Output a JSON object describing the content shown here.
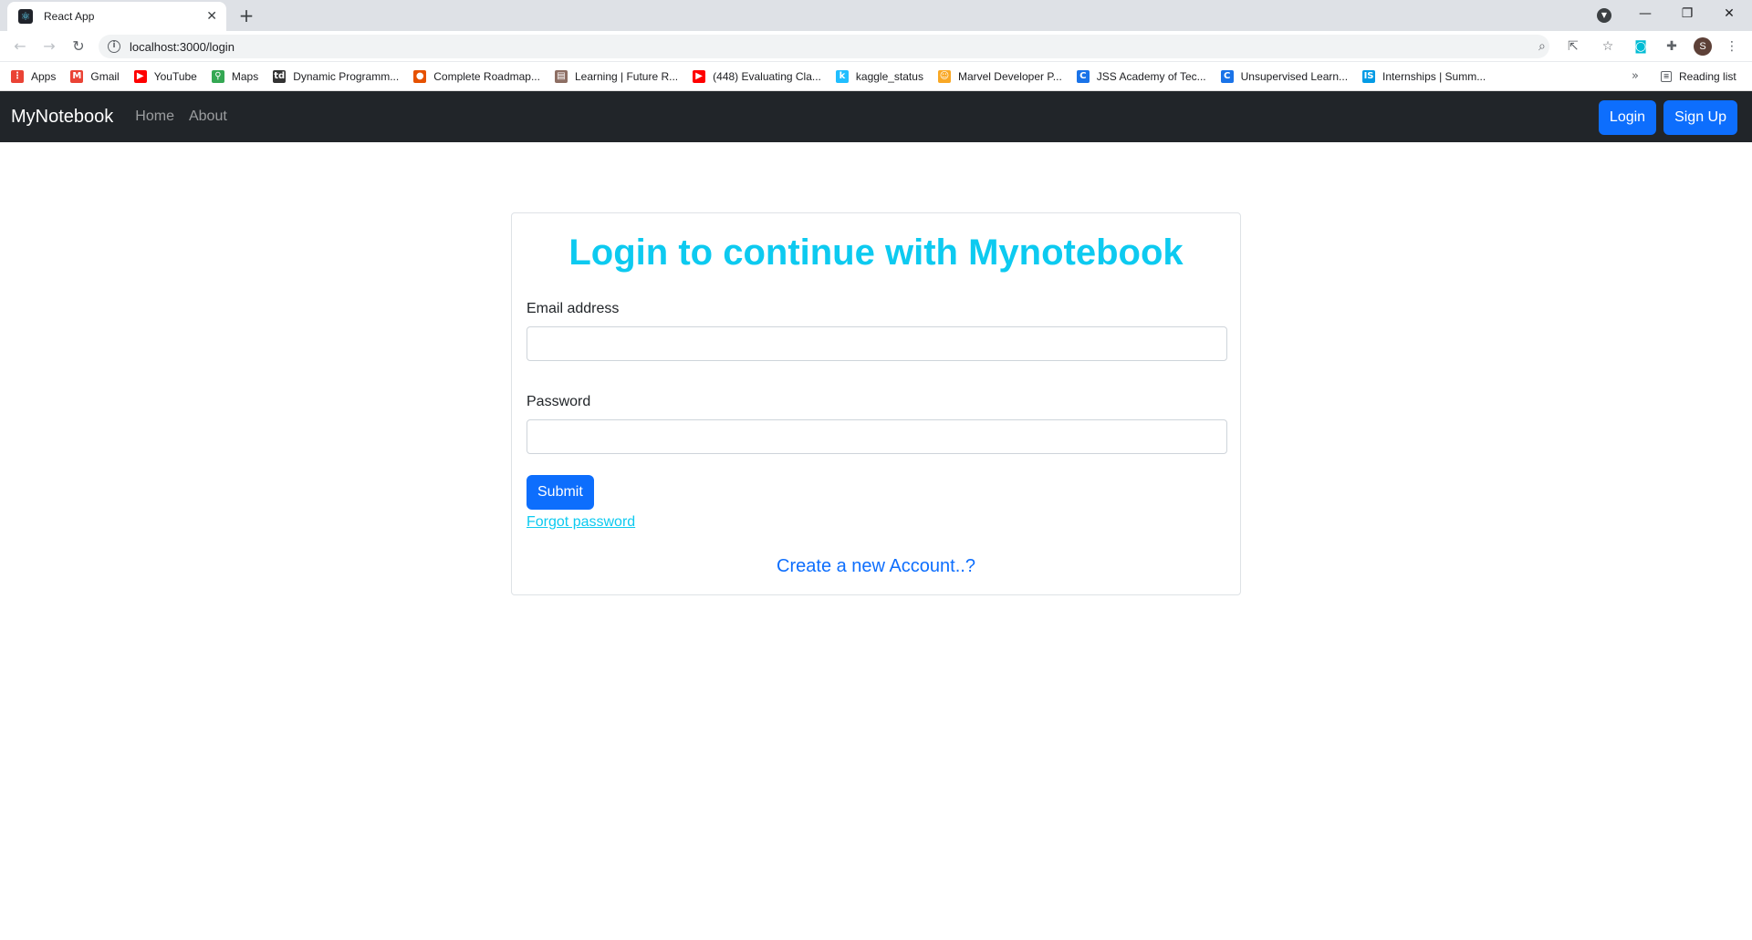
{
  "browser": {
    "tab_title": "React App",
    "url": "localhost:3000/login",
    "bookmarks": [
      {
        "label": "Apps",
        "icon": "apps-grid-icon",
        "color": "#ea4335"
      },
      {
        "label": "Gmail",
        "icon": "gmail-icon",
        "color": "#ea4335"
      },
      {
        "label": "YouTube",
        "icon": "youtube-icon",
        "color": "#ff0000"
      },
      {
        "label": "Maps",
        "icon": "maps-icon",
        "color": "#34a853"
      },
      {
        "label": "Dynamic Programm...",
        "icon": "td-icon",
        "color": "#333333"
      },
      {
        "label": "Complete Roadmap...",
        "icon": "roadmap-icon",
        "color": "#e65100"
      },
      {
        "label": "Learning | Future R...",
        "icon": "learning-icon",
        "color": "#8d6e63"
      },
      {
        "label": "(448) Evaluating Cla...",
        "icon": "youtube-icon",
        "color": "#ff0000"
      },
      {
        "label": "kaggle_status",
        "icon": "kaggle-icon",
        "color": "#20beff"
      },
      {
        "label": "Marvel Developer P...",
        "icon": "marvel-icon",
        "color": "#f9a825"
      },
      {
        "label": "JSS Academy of Tec...",
        "icon": "jss-icon",
        "color": "#1a73e8"
      },
      {
        "label": "Unsupervised Learn...",
        "icon": "unsupervised-icon",
        "color": "#1a73e8"
      },
      {
        "label": "Internships | Summ...",
        "icon": "internshala-icon",
        "color": "#039be5"
      }
    ],
    "reading_list": "Reading list",
    "avatar_letter": "S"
  },
  "navbar": {
    "brand": "MyNotebook",
    "links": [
      "Home",
      "About"
    ],
    "login_label": "Login",
    "signup_label": "Sign Up"
  },
  "login": {
    "title": "Login to continue with Mynotebook",
    "email_label": "Email address",
    "email_value": "",
    "password_label": "Password",
    "password_value": "",
    "submit_label": "Submit",
    "forgot_label": "Forgot password",
    "create_label": "Create a new Account..?"
  },
  "colors": {
    "navbar_bg": "#212529",
    "primary": "#0d6efd",
    "accent_info": "#0dcaf0"
  }
}
